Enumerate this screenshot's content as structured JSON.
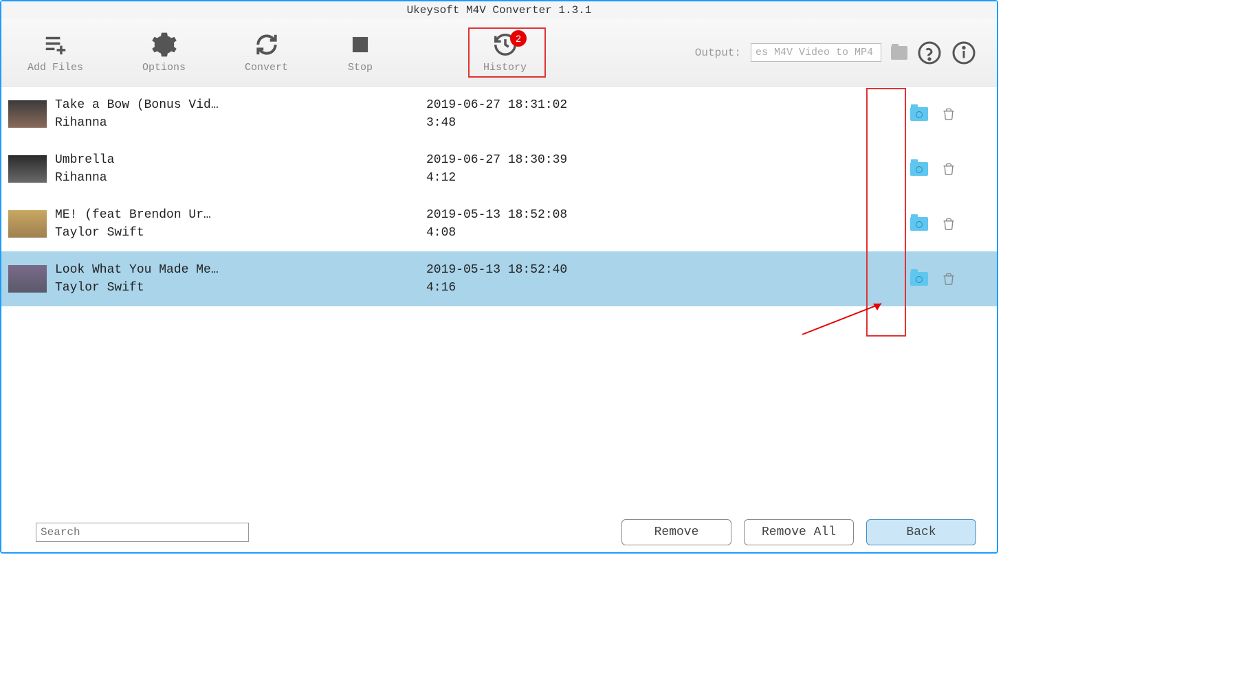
{
  "app_title": "Ukeysoft M4V Converter 1.3.1",
  "toolbar": {
    "add_files": "Add Files",
    "options": "Options",
    "convert": "Convert",
    "stop": "Stop",
    "history": "History",
    "history_badge": "2",
    "output_label": "Output:",
    "output_value": "es M4V Video to MP4"
  },
  "rows": [
    {
      "title": "Take a Bow (Bonus Vid…",
      "artist": "Rihanna",
      "date": "2019-06-27 18:31:02",
      "duration": "3:48"
    },
    {
      "title": "Umbrella",
      "artist": "Rihanna",
      "date": "2019-06-27 18:30:39",
      "duration": "4:12"
    },
    {
      "title": "ME! (feat  Brendon Ur…",
      "artist": "Taylor Swift",
      "date": "2019-05-13 18:52:08",
      "duration": "4:08"
    },
    {
      "title": "Look What You Made Me…",
      "artist": "Taylor Swift",
      "date": "2019-05-13 18:52:40",
      "duration": "4:16"
    }
  ],
  "selected_index": 3,
  "footer": {
    "search_placeholder": "Search",
    "remove": "Remove",
    "remove_all": "Remove All",
    "back": "Back"
  }
}
